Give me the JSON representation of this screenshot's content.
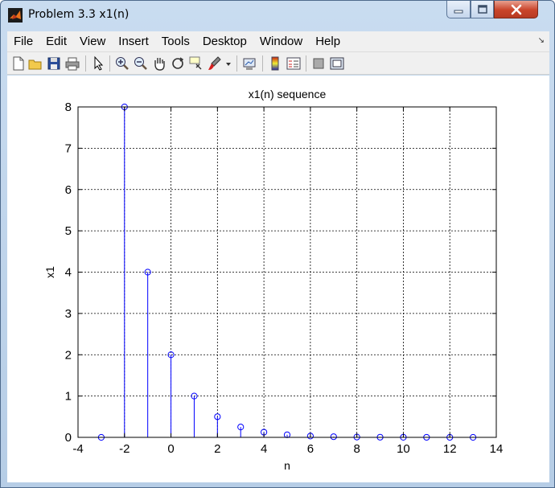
{
  "window": {
    "title": "Problem 3.3 x1(n)",
    "title_bar_color": "#c9dcf0",
    "controls": {
      "minimize_icon": "minimize-icon",
      "maximize_icon": "maximize-icon",
      "close_icon": "close-icon"
    }
  },
  "menubar": {
    "items": [
      "File",
      "Edit",
      "View",
      "Insert",
      "Tools",
      "Desktop",
      "Window",
      "Help"
    ]
  },
  "toolbar": {
    "icons": [
      "new-figure-icon",
      "open-file-icon",
      "save-icon",
      "print-icon",
      "edit-plot-arrow-icon",
      "zoom-in-icon",
      "zoom-out-icon",
      "pan-hand-icon",
      "rotate-3d-icon",
      "data-cursor-icon",
      "brush-icon",
      "brush-dropdown-icon",
      "link-plot-icon",
      "colorbar-icon",
      "legend-icon",
      "hide-plot-tools-icon",
      "show-plot-tools-icon"
    ]
  },
  "chart_data": {
    "type": "stem",
    "title": "x1(n) sequence",
    "xlabel": "n",
    "ylabel": "x1",
    "xlim": [
      -4,
      14
    ],
    "ylim": [
      0,
      8
    ],
    "xticks": [
      -4,
      -2,
      0,
      2,
      4,
      6,
      8,
      10,
      12,
      14
    ],
    "yticks": [
      0,
      1,
      2,
      3,
      4,
      5,
      6,
      7,
      8
    ],
    "grid": true,
    "color": "#0000ff",
    "x": [
      -3,
      -2,
      -1,
      0,
      1,
      2,
      3,
      4,
      5,
      6,
      7,
      8,
      9,
      10,
      11,
      12,
      13
    ],
    "values": [
      0,
      8,
      4,
      2,
      1,
      0.5,
      0.25,
      0.125,
      0.0625,
      0.03125,
      0.015625,
      0.0078125,
      0.00390625,
      0.001953125,
      0.0009765625,
      0.00048828125,
      0
    ]
  }
}
